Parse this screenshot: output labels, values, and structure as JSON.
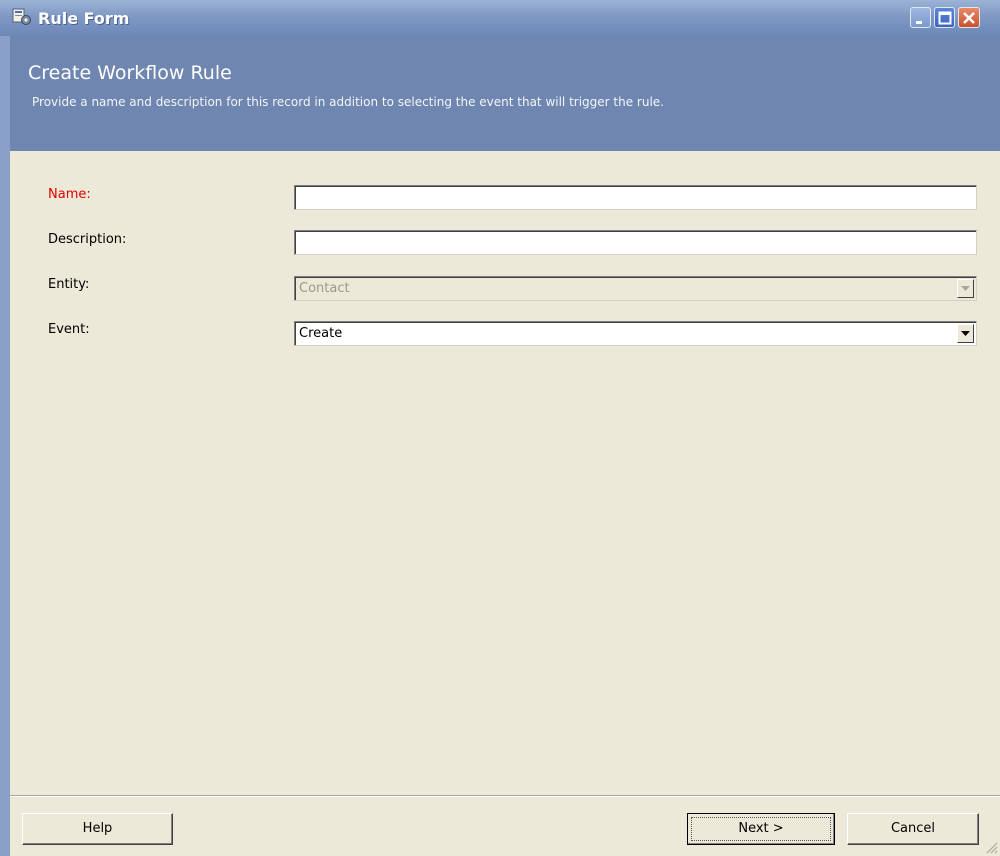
{
  "window": {
    "title": "Rule Form"
  },
  "banner": {
    "title": "Create Workflow Rule",
    "description": "Provide a name and description for this record in addition to selecting the event that will trigger the rule."
  },
  "form": {
    "name": {
      "label": "Name:",
      "value": "",
      "required": true
    },
    "description": {
      "label": "Description:",
      "value": ""
    },
    "entity": {
      "label": "Entity:",
      "value": "Contact",
      "disabled": true
    },
    "event": {
      "label": "Event:",
      "value": "Create"
    }
  },
  "buttons": {
    "help": "Help",
    "next": "Next >",
    "cancel": "Cancel"
  },
  "colors": {
    "banner": "#6f87b0",
    "required_label": "#e00000",
    "face": "#ece9d8"
  },
  "icons": {
    "app": "workflow-rule-icon",
    "minimize": "minimize-icon",
    "maximize": "maximize-icon",
    "close": "close-icon"
  }
}
